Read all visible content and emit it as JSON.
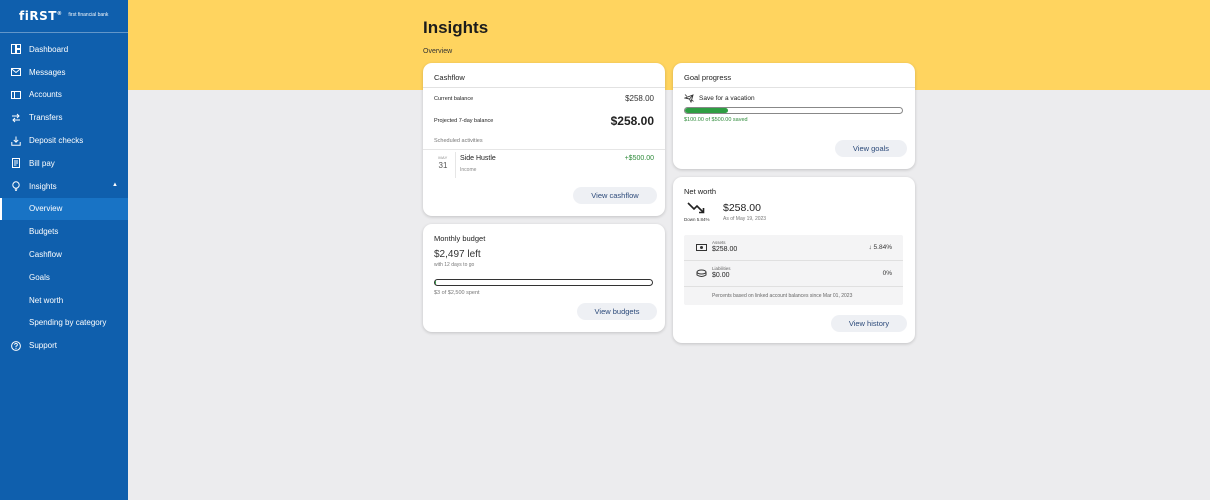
{
  "brand": {
    "logo": "fiRST",
    "name": "first financial bank"
  },
  "sidebar": {
    "items": [
      {
        "label": "Dashboard",
        "icon": "dashboard-icon"
      },
      {
        "label": "Messages",
        "icon": "mail-icon"
      },
      {
        "label": "Accounts",
        "icon": "accounts-icon"
      },
      {
        "label": "Transfers",
        "icon": "transfer-icon"
      },
      {
        "label": "Deposit checks",
        "icon": "deposit-icon"
      },
      {
        "label": "Bill pay",
        "icon": "bill-icon"
      },
      {
        "label": "Insights",
        "icon": "lightbulb-icon",
        "expanded": true
      }
    ],
    "subitems": [
      {
        "label": "Overview",
        "active": true
      },
      {
        "label": "Budgets"
      },
      {
        "label": "Cashflow"
      },
      {
        "label": "Goals"
      },
      {
        "label": "Net worth"
      },
      {
        "label": "Spending by category"
      }
    ],
    "support": {
      "label": "Support",
      "icon": "help-icon"
    }
  },
  "page": {
    "title": "Insights",
    "breadcrumb": "Overview"
  },
  "cashflow": {
    "title": "Cashflow",
    "current_balance_label": "Current balance",
    "current_balance": "$258.00",
    "projected_label": "Projected 7-day balance",
    "projected_balance": "$258.00",
    "scheduled_label": "Scheduled activities",
    "activity": {
      "month": "MAY",
      "day": "31",
      "name": "Side Hustle",
      "type": "Income",
      "amount": "+$500.00"
    },
    "button": "View cashflow"
  },
  "goals": {
    "title": "Goal progress",
    "goal_name": "Save for a vacation",
    "progress": 0.2,
    "summary": "$100.00 of $500.00 saved",
    "button": "View goals"
  },
  "budget": {
    "title": "Monthly budget",
    "left": "$2,497 left",
    "days_note": "with 12 days to go",
    "spent_fraction": 0.002,
    "summary": "$3 of $2,500 spent",
    "button": "View budgets"
  },
  "networth": {
    "title": "Net worth",
    "change": "Down 5.84%",
    "amount": "$258.00",
    "as_of": "As of May 19, 2023",
    "assets_label": "Assets",
    "assets_value": "$258.00",
    "assets_pct": "↓ 5.84%",
    "liabilities_label": "Liabilities",
    "liabilities_value": "$0.00",
    "liabilities_pct": "0%",
    "footnote": "Percents based on linked account balances since Mar 01, 2023",
    "button": "View history"
  },
  "colors": {
    "sidebar": "#0f5fad",
    "banner": "#ffd45f",
    "positive": "#2e8b3a",
    "progress": "#2e9e42"
  }
}
